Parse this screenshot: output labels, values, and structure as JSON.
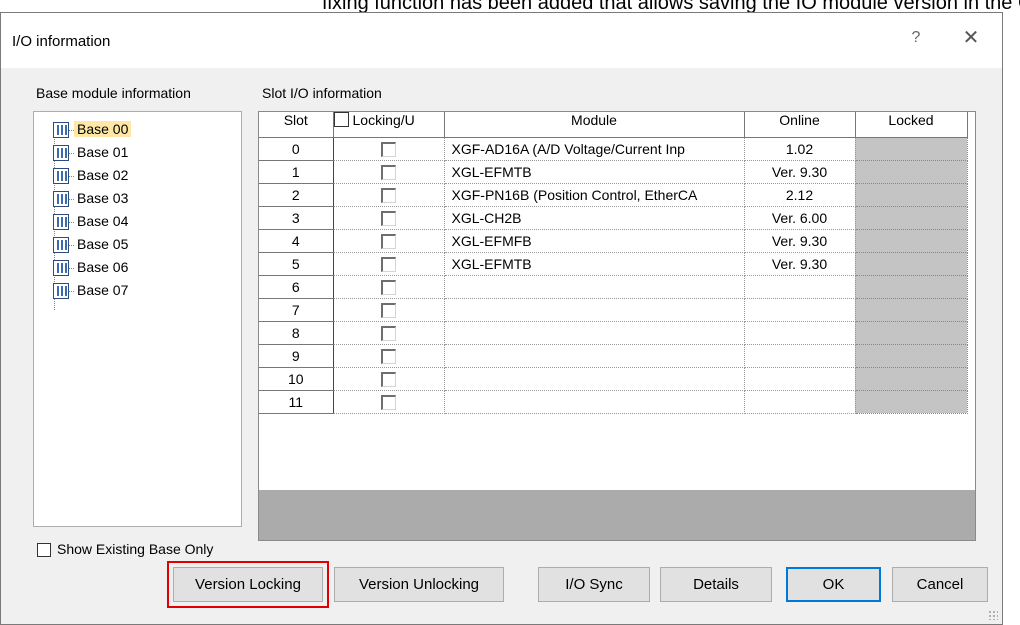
{
  "doc_fragment": "fixing function has been added that allows saving the IO module version in the CPU.",
  "dialog": {
    "title": "I/O information",
    "help_glyph": "?",
    "close_glyph": "✕"
  },
  "base_panel": {
    "label": "Base module information",
    "items": [
      "Base 00",
      "Base 01",
      "Base 02",
      "Base 03",
      "Base 04",
      "Base 05",
      "Base 06",
      "Base 07"
    ],
    "selected": "Base 00"
  },
  "slot_panel": {
    "label": "Slot I/O information",
    "headers": {
      "slot": "Slot",
      "locking": "Locking/U",
      "module": "Module",
      "online": "Online",
      "locked": "Locked"
    },
    "rows": [
      {
        "slot": "0",
        "module": "XGF-AD16A (A/D Voltage/Current Inp",
        "online": "1.02"
      },
      {
        "slot": "1",
        "module": "XGL-EFMTB",
        "online": "Ver. 9.30"
      },
      {
        "slot": "2",
        "module": "XGF-PN16B (Position Control, EtherCA",
        "online": "2.12"
      },
      {
        "slot": "3",
        "module": "XGL-CH2B",
        "online": "Ver. 6.00"
      },
      {
        "slot": "4",
        "module": "XGL-EFMFB",
        "online": "Ver. 9.30"
      },
      {
        "slot": "5",
        "module": "XGL-EFMTB",
        "online": "Ver. 9.30"
      },
      {
        "slot": "6",
        "module": "",
        "online": ""
      },
      {
        "slot": "7",
        "module": "",
        "online": ""
      },
      {
        "slot": "8",
        "module": "",
        "online": ""
      },
      {
        "slot": "9",
        "module": "",
        "online": ""
      },
      {
        "slot": "10",
        "module": "",
        "online": ""
      },
      {
        "slot": "11",
        "module": "",
        "online": ""
      }
    ]
  },
  "show_existing": {
    "label": "Show Existing Base Only",
    "checked": false
  },
  "buttons": {
    "version_locking": "Version Locking",
    "version_unlocking": "Version Unlocking",
    "io_sync": "I/O Sync",
    "details": "Details",
    "ok": "OK",
    "cancel": "Cancel"
  },
  "colors": {
    "highlight_outline": "#e00000",
    "selected_tree_bg": "#ffe8a6",
    "locked_column_bg": "#c4c4c4",
    "default_button_border": "#0078d7"
  }
}
